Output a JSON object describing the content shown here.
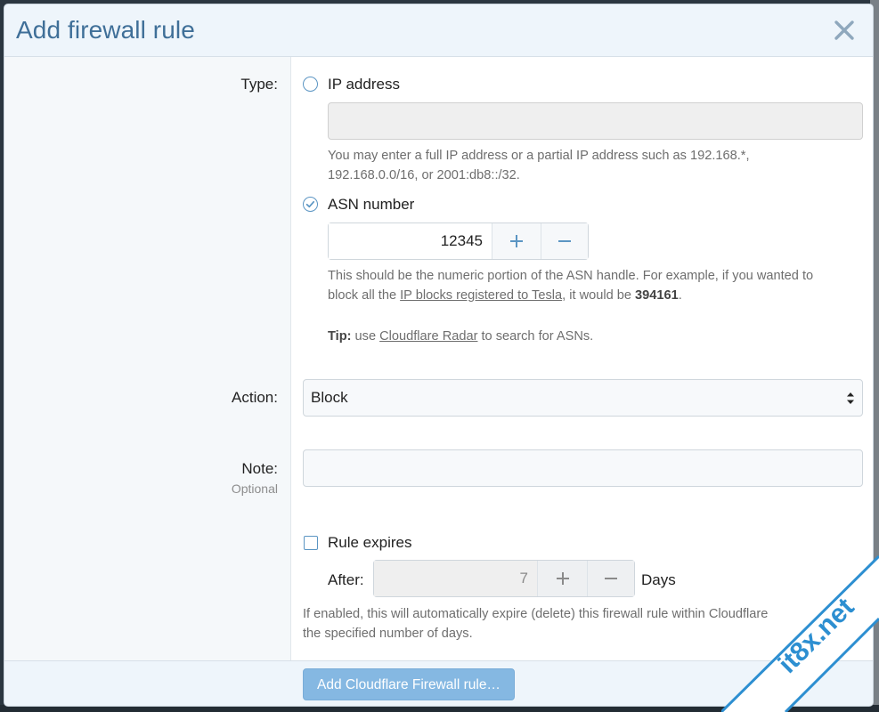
{
  "modal": {
    "title": "Add firewall rule",
    "close_icon": "close-icon"
  },
  "type_row": {
    "label": "Type:",
    "options": [
      {
        "label": "IP address",
        "checked": false
      },
      {
        "label": "ASN number",
        "checked": true
      }
    ],
    "ip_input_value": "",
    "ip_help_line1": "You may enter a full IP address or a partial IP address such as 192.168.*,",
    "ip_help_line2": "192.168.0.0/16, or 2001:db8::/32.",
    "asn_value": "12345",
    "asn_help_line1": "This should be the numeric portion of the ASN handle. For example, if you wanted to",
    "asn_help_line2_pre": "block all the ",
    "asn_help_link": "IP blocks registered to Tesla",
    "asn_help_line2_mid": ", it would be ",
    "asn_help_bold": "394161",
    "asn_help_line2_end": ".",
    "tip_bold": "Tip:",
    "tip_pre": " use ",
    "tip_link": "Cloudflare Radar",
    "tip_end": " to search for ASNs."
  },
  "action_row": {
    "label": "Action:",
    "selected": "Block"
  },
  "note_row": {
    "label": "Note:",
    "sublabel": "Optional",
    "value": ""
  },
  "expires_row": {
    "checkbox_label": "Rule expires",
    "checked": false,
    "after_label": "After:",
    "days_value": "7",
    "days_label": "Days",
    "help_line1": "If enabled, this will automatically expire (delete) this firewall rule within Cloudflare",
    "help_line2": "the specified number of days."
  },
  "footer": {
    "submit_label": "Add Cloudflare Firewall rule…"
  },
  "watermark": {
    "text": "it8x.net"
  },
  "colors": {
    "title": "#3f6f98",
    "accent": "#5b95c3",
    "submit_bg": "#85b8e2",
    "header_bg": "#eef5fb"
  }
}
